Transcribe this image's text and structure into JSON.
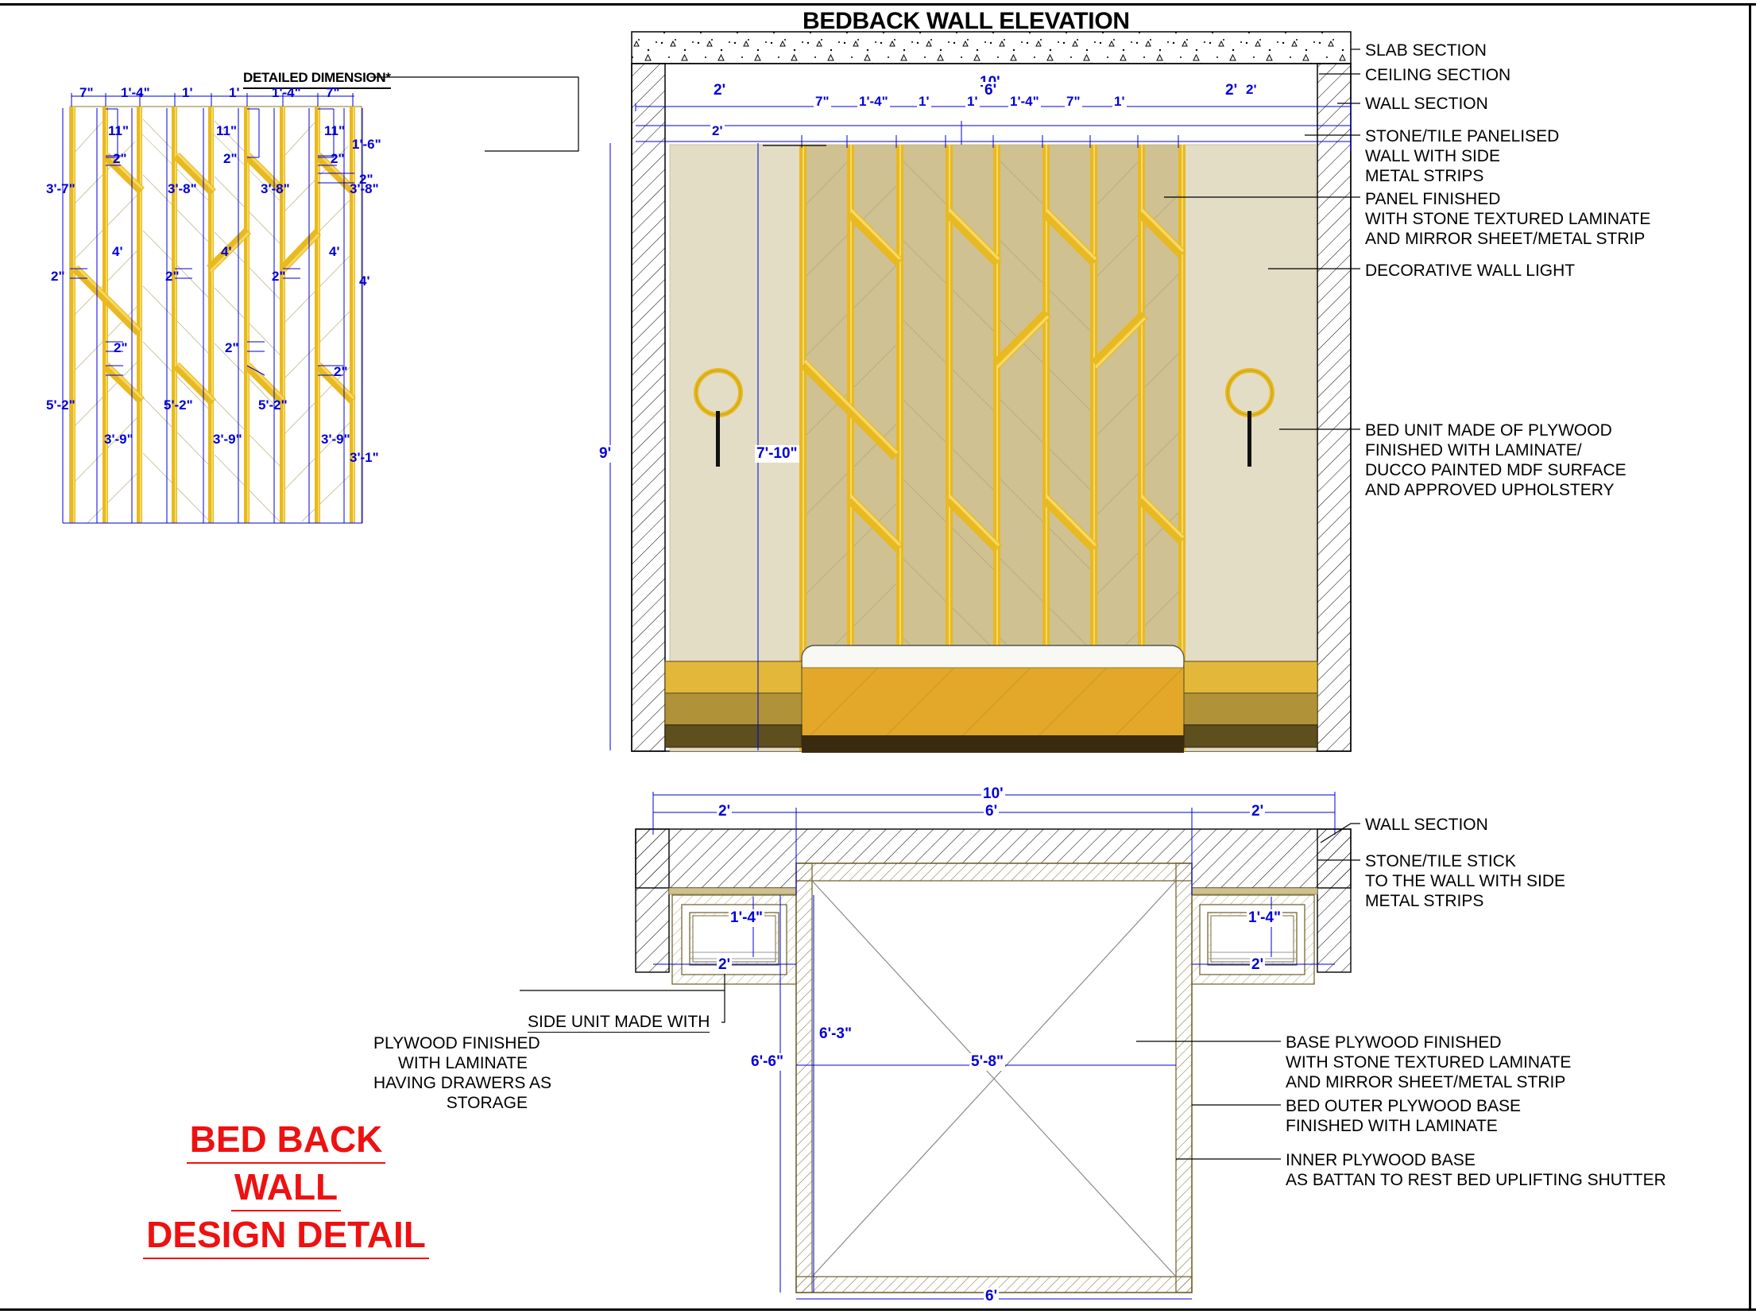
{
  "sheet": {
    "elevation_title": "BEDBACK WALL ELEVATION",
    "detail_title": "DETAILED DIMENSION*",
    "drawing_title_line1": "BED BACK",
    "drawing_title_line2": "WALL",
    "drawing_title_line3": "DESIGN DETAIL",
    "title_color": "#ee1111",
    "dimension_color": "#0000d8",
    "panel_color": "#cfc192",
    "panel_light_color": "#e3ddc6",
    "metal_strip_color": "#f2c218",
    "wood_color": "#8a7a34"
  },
  "elevation_annotations": [
    {
      "id": "slab-section",
      "text": "SLAB SECTION"
    },
    {
      "id": "ceiling-section",
      "text": "CEILING SECTION"
    },
    {
      "id": "wall-section",
      "text": "WALL SECTION"
    },
    {
      "id": "stone-tile-panelised",
      "text": "STONE/TILE PANELISED\nWALL WITH SIDE\nMETAL STRIPS"
    },
    {
      "id": "panel-finished",
      "text": "PANEL FINISHED\nWITH STONE TEXTURED LAMINATE\nAND MIRROR SHEET/METAL STRIP"
    },
    {
      "id": "decorative-wall-light",
      "text": "DECORATIVE WALL LIGHT"
    },
    {
      "id": "bed-unit",
      "text": "BED UNIT MADE OF PLYWOOD\nFINISHED WITH LAMINATE/\nDUCCO PAINTED MDF SURFACE\nAND APPROVED UPHOLSTERY"
    }
  ],
  "plan_annotations": [
    {
      "id": "wall-section-plan",
      "text": "WALL SECTION"
    },
    {
      "id": "stone-tile-stick",
      "text": "STONE/TILE STICK\nTO THE WALL WITH SIDE\nMETAL STRIPS"
    },
    {
      "id": "base-plywood",
      "text": "BASE PLYWOOD FINISHED\nWITH STONE TEXTURED LAMINATE\nAND MIRROR SHEET/METAL STRIP"
    },
    {
      "id": "bed-outer-plywood",
      "text": "BED OUTER PLYWOOD BASE\nFINISHED WITH LAMINATE"
    },
    {
      "id": "inner-plywood",
      "text": "INNER PLYWOOD BASE\nAS BATTAN TO REST BED UPLIFTING SHUTTER"
    },
    {
      "id": "side-unit",
      "text_line1": "SIDE UNIT MADE WITH",
      "text_rest": "PLYWOOD FINISHED\nWITH LAMINATE\nHAVING DRAWERS AS\nSTORAGE"
    }
  ],
  "elevation_dimensions": {
    "overall_width": "10'",
    "center_width": "6'",
    "left_side": "2'",
    "right_side": "2'",
    "panel_widths": [
      "7\"",
      "1'-4\"",
      "1'",
      "1'",
      "1'-4\"",
      "7\""
    ],
    "overall_height": "9'",
    "panel_height": "7'-10\""
  },
  "detail_dimensions": {
    "top_row": [
      "7\"",
      "1'-4\"",
      "1'",
      "1'",
      "1'-4\"",
      "7\""
    ],
    "eleven_inch": [
      "11\"",
      "11\"",
      "11\""
    ],
    "two_inch": "2\"",
    "one_six": "1'-6\"",
    "heights_upper": [
      "3'-7\"",
      "3'-8\"",
      "3'-8\"",
      "3'-8\""
    ],
    "four_feet": [
      "4'",
      "4'",
      "4'"
    ],
    "heights_lower": [
      "5'-2\"",
      "5'-2\"",
      "5'-2\""
    ],
    "bottom_row": [
      "3'-9\"",
      "3'-9\"",
      "3'-9\"",
      "3'-1\""
    ]
  },
  "plan_dimensions": {
    "overall_width": "10'",
    "center_width": "6'",
    "left_side": "2'",
    "right_side": "2'",
    "side_unit_depth_left": "1'-4\"",
    "side_unit_depth_right": "1'-4\"",
    "side_unit_width_left": "2'",
    "side_unit_width_right": "2'",
    "bed_depth_outer": "6'-6\"",
    "bed_depth_inner": "6'-3\"",
    "bed_width_inner": "5'-8\"",
    "bed_width_outer": "6'"
  }
}
